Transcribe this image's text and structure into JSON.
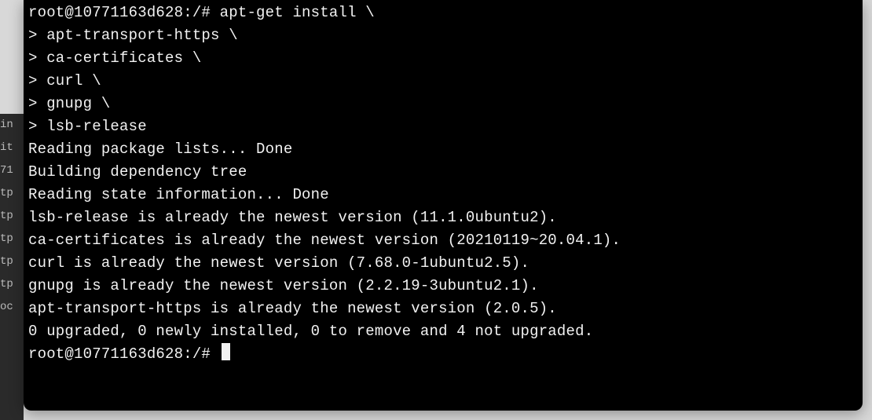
{
  "background_window": {
    "fragments": [
      "",
      "in",
      "it",
      "71",
      "tp",
      "tp",
      "tp",
      "",
      "tp",
      "",
      "",
      "tp",
      "oc"
    ]
  },
  "terminal": {
    "prompt": "root@10771163d628:/#",
    "command_lines": [
      "root@10771163d628:/# apt-get install \\",
      "> apt-transport-https \\",
      "> ca-certificates \\",
      "> curl \\",
      "> gnupg \\",
      "> lsb-release"
    ],
    "output_lines": [
      "Reading package lists... Done",
      "Building dependency tree",
      "Reading state information... Done",
      "lsb-release is already the newest version (11.1.0ubuntu2).",
      "ca-certificates is already the newest version (20210119~20.04.1).",
      "curl is already the newest version (7.68.0-1ubuntu2.5).",
      "gnupg is already the newest version (2.2.19-3ubuntu2.1).",
      "apt-transport-https is already the newest version (2.0.5).",
      "0 upgraded, 0 newly installed, 0 to remove and 4 not upgraded."
    ],
    "next_prompt": "root@10771163d628:/# "
  }
}
